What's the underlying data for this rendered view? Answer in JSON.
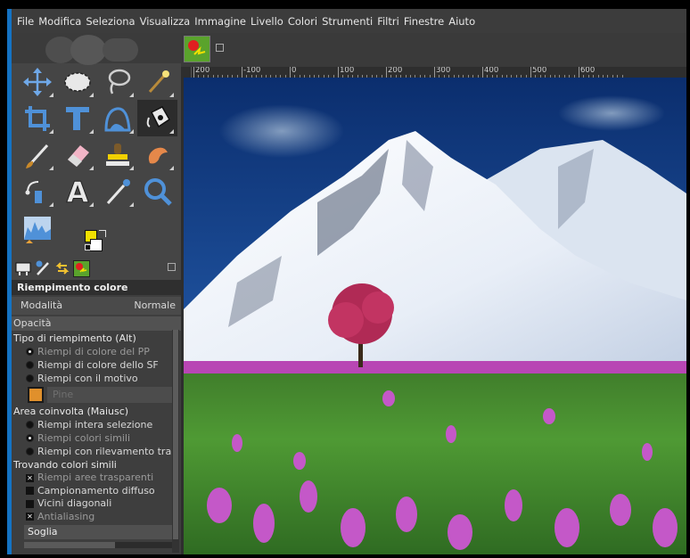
{
  "menubar": {
    "items": [
      "File",
      "Modifica",
      "Seleziona",
      "Visualizza",
      "Immagine",
      "Livello",
      "Colori",
      "Strumenti",
      "Filtri",
      "Finestre",
      "Aiuto"
    ]
  },
  "toolbox": {
    "tools": [
      [
        "move-tool",
        "ellipse-select-tool",
        "free-select-tool",
        "fuzzy-select-tool"
      ],
      [
        "crop-tool",
        "unified-transform-tool",
        "warp-transform-tool",
        "bucket-fill-tool"
      ],
      [
        "paintbrush-tool",
        "eraser-tool",
        "clone-tool",
        "smudge-tool"
      ],
      [
        "paths-tool",
        "text-tool",
        "color-picker-tool",
        "zoom-tool"
      ],
      [
        "levels-tool"
      ]
    ],
    "active_tool": "bucket-fill-tool",
    "fg_color": "#f2e000",
    "bg_color": "#ffffff"
  },
  "tool_options": {
    "title": "Riempimento colore",
    "mode_label": "Modalità",
    "mode_value": "Normale",
    "opacity_label": "Opacità",
    "fill_type_heading": "Tipo di riempimento (Alt)",
    "fill_type_options": [
      {
        "label": "Riempi di colore del PP",
        "selected": true
      },
      {
        "label": "Riempi di colore dello SF",
        "selected": false
      },
      {
        "label": "Riempi con il motivo",
        "selected": false
      }
    ],
    "pattern_name": "Pine",
    "affected_area_heading": "Area coinvolta  (Maiusc)",
    "affected_area_options": [
      {
        "label": "Riempi intera selezione",
        "selected": false
      },
      {
        "label": "Riempi colori simili",
        "selected": true
      },
      {
        "label": "Riempi con rilevamento tra",
        "selected": false
      }
    ],
    "similar_colors_heading": "Trovando colori simili",
    "similar_colors_checks": [
      {
        "label": "Riempi aree trasparenti",
        "checked": true
      },
      {
        "label": "Campionamento diffuso",
        "checked": false
      },
      {
        "label": "Vicini diagonali",
        "checked": false
      },
      {
        "label": "Antialiasing",
        "checked": true
      }
    ],
    "threshold_label": "Soglia"
  },
  "ruler": {
    "labels": [
      "200",
      "-100",
      "0",
      "100",
      "200",
      "300",
      "400",
      "500",
      "600"
    ]
  },
  "colors": {
    "menubar_bg": "#3c3c3c",
    "panel_bg": "#454545",
    "accent_blue": "#1473c4"
  }
}
